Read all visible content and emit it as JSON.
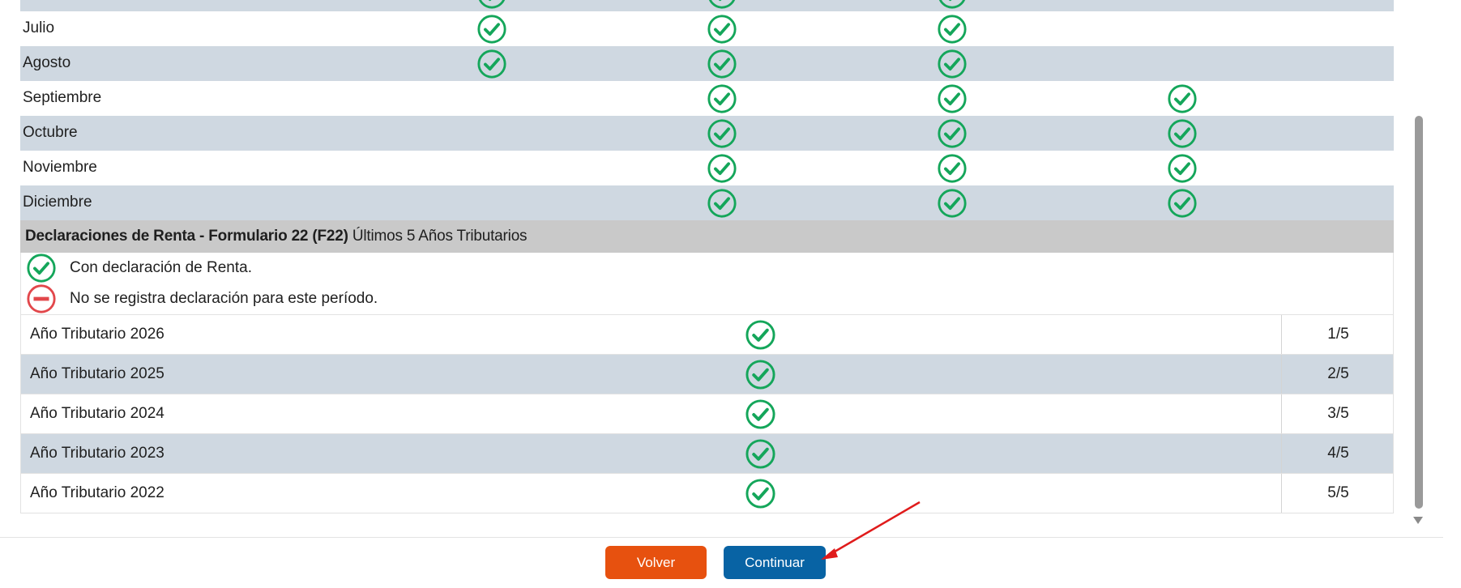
{
  "monthly": {
    "rows": [
      {
        "label": "Julio",
        "checks": [
          true,
          true,
          true,
          false
        ]
      },
      {
        "label": "Agosto",
        "checks": [
          true,
          true,
          true,
          false
        ]
      },
      {
        "label": "Septiembre",
        "checks": [
          false,
          true,
          true,
          true
        ]
      },
      {
        "label": "Octubre",
        "checks": [
          false,
          true,
          true,
          true
        ]
      },
      {
        "label": "Noviembre",
        "checks": [
          false,
          true,
          true,
          true
        ]
      },
      {
        "label": "Diciembre",
        "checks": [
          false,
          true,
          true,
          true
        ]
      }
    ]
  },
  "f22": {
    "title_bold": "Declaraciones de Renta - Formulario 22 (F22)",
    "title_rest": " Últimos 5 Años Tributarios",
    "legend_with": "Con declaración de Renta.",
    "legend_without": "No se registra declaración para este período.",
    "years": [
      {
        "label": "Año Tributario 2026",
        "fraction": "1/5"
      },
      {
        "label": "Año Tributario 2025",
        "fraction": "2/5"
      },
      {
        "label": "Año Tributario 2024",
        "fraction": "3/5"
      },
      {
        "label": "Año Tributario 2023",
        "fraction": "4/5"
      },
      {
        "label": "Año Tributario 2022",
        "fraction": "5/5"
      }
    ]
  },
  "buttons": {
    "back": "Volver",
    "continue": "Continuar"
  },
  "colors": {
    "check": "#14a65a",
    "no_record": "#e2474b",
    "back_btn": "#e7510f",
    "continue_btn": "#0863a4",
    "row_shade": "#cfd8e1",
    "arrow": "#e01b1b"
  },
  "icons": {
    "check": "check-circle-icon",
    "no_record": "minus-circle-icon"
  }
}
